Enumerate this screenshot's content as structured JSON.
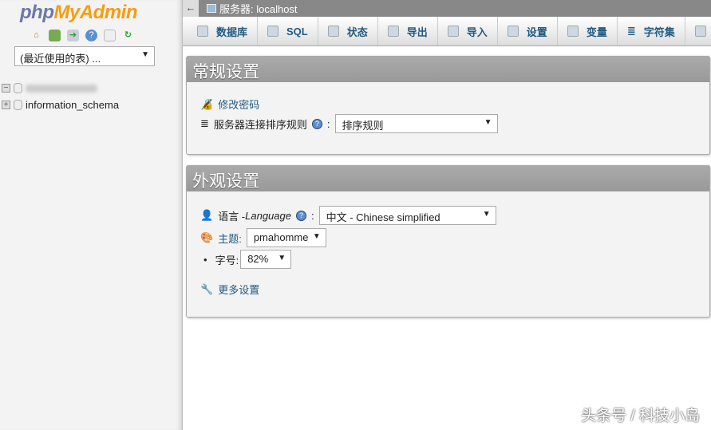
{
  "sidebar": {
    "logo_php": "php",
    "logo_myadmin": "MyAdmin",
    "icons": [
      "home-icon",
      "logout-icon",
      "query-window-icon",
      "help-icon",
      "docs-icon",
      "reload-icon"
    ],
    "recent_tables": "(最近使用的表) ...",
    "databases": [
      "information_schema"
    ]
  },
  "topbar": {
    "back": "←",
    "server": "服务器: localhost"
  },
  "tabs": [
    {
      "label": "数据库",
      "icon": "database-icon"
    },
    {
      "label": "SQL",
      "icon": "sql-icon"
    },
    {
      "label": "状态",
      "icon": "status-icon"
    },
    {
      "label": "导出",
      "icon": "export-icon"
    },
    {
      "label": "导入",
      "icon": "import-icon"
    },
    {
      "label": "设置",
      "icon": "wrench-icon"
    },
    {
      "label": "变量",
      "icon": "variables-icon"
    },
    {
      "label": "字符集",
      "icon": "charset-icon"
    }
  ],
  "general": {
    "title": "常规设置",
    "change_password": "修改密码",
    "collation_label": "服务器连接排序规则",
    "colon": ":",
    "collation_value": "排序规则"
  },
  "appearance": {
    "title": "外观设置",
    "language_label": "语言 - ",
    "language_en": "Language",
    "language_value": "中文 - Chinese simplified",
    "theme_label": "主题:",
    "theme_value": "pmahomme",
    "fontsize_label": "字号:",
    "fontsize_value": "82%",
    "more_settings": "更多设置"
  },
  "watermark": "头条号 / 科技小岛"
}
